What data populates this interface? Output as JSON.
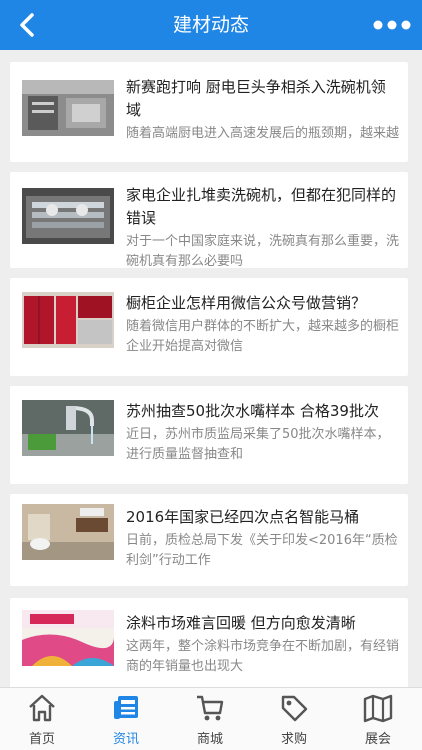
{
  "header": {
    "title": "建材动态",
    "back_icon": "chevron-left-icon",
    "more_icon": "more-dots-icon",
    "bg_color": "#1f86e6"
  },
  "news": [
    {
      "title": "新赛跑打响 厨电巨头争相杀入洗碗机领域",
      "desc": "随着高端厨电进入高速发展后的瓶颈期，越来越多的厨电巨头将目光"
    },
    {
      "title": "家电企业扎堆卖洗碗机，但都在犯同样的错误",
      "desc": "对于一个中国家庭来说，洗碗真有那么重要，洗碗机真有那么必要吗"
    },
    {
      "title": "橱柜企业怎样用微信公众号做营销？",
      "desc": "随着微信用户群体的不断扩大，越来越多的橱柜企业开始提高对微信"
    },
    {
      "title": "苏州抽查50批次水嘴样本 合格39批次",
      "desc": "近日，苏州市质监局采集了50批次水嘴样本，进行质量监督抽查和"
    },
    {
      "title": "2016年国家已经四次点名智能马桶",
      "desc": "日前，质检总局下发《关于印发<2016年“质检利剑”行动工作"
    },
    {
      "title": "涂料市场难言回暖 但方向愈发清晰",
      "desc": "这两年，整个涂料市场竞争在不断加剧，有经销商的年销量也出现大"
    }
  ],
  "tabbar": {
    "active_color": "#1f86e6",
    "items": [
      {
        "label": "首页",
        "icon": "home-icon"
      },
      {
        "label": "资讯",
        "icon": "news-icon"
      },
      {
        "label": "商城",
        "icon": "cart-icon"
      },
      {
        "label": "求购",
        "icon": "tag-icon"
      },
      {
        "label": "展会",
        "icon": "map-icon"
      }
    ]
  }
}
